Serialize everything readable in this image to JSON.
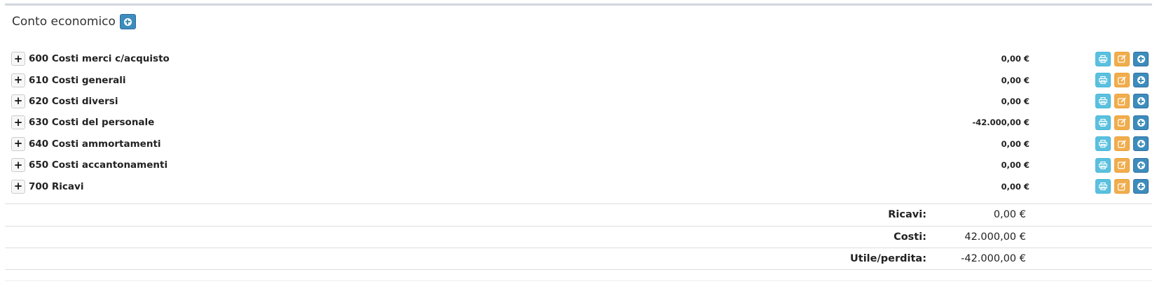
{
  "panel": {
    "title": "Conto economico",
    "add_icon": "plus-circle-icon"
  },
  "accounts": [
    {
      "code_name": "600 Costi merci c/acquisto",
      "amount": "0,00 €"
    },
    {
      "code_name": "610 Costi generali",
      "amount": "0,00 €"
    },
    {
      "code_name": "620 Costi diversi",
      "amount": "0,00 €"
    },
    {
      "code_name": "630 Costi del personale",
      "amount": "-42.000,00 €"
    },
    {
      "code_name": "640 Costi ammortamenti",
      "amount": "0,00 €"
    },
    {
      "code_name": "650 Costi accantonamenti",
      "amount": "0,00 €"
    },
    {
      "code_name": "700 Ricavi",
      "amount": "0,00 €"
    }
  ],
  "row_controls": {
    "expand_symbol": "+",
    "print_icon": "print-icon",
    "edit_icon": "edit-icon",
    "add_icon": "plus-circle-icon"
  },
  "totals": {
    "ricavi_label": "Ricavi:",
    "ricavi_value": "0,00 €",
    "costi_label": "Costi:",
    "costi_value": "42.000,00 €",
    "utile_label": "Utile/perdita:",
    "utile_value": "-42.000,00 €"
  },
  "colors": {
    "primary": "#3c8dbc",
    "info": "#5bc0de",
    "warning": "#f0ad4e"
  }
}
